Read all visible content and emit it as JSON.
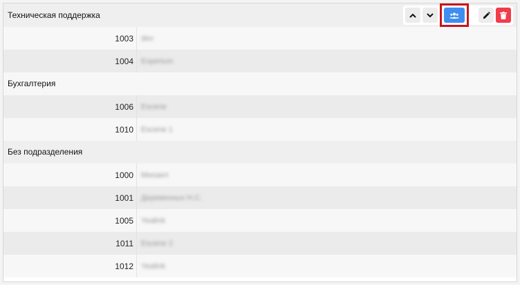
{
  "groups": [
    {
      "title": "Техническая поддержка",
      "rows": [
        {
          "number": "1003",
          "name": "dev"
        },
        {
          "number": "1004",
          "name": "Experium"
        }
      ]
    },
    {
      "title": "Бухгалтерия",
      "rows": [
        {
          "number": "1006",
          "name": "Escene"
        },
        {
          "number": "1010",
          "name": "Escene 1"
        }
      ]
    },
    {
      "title": "Без подразделения",
      "rows": [
        {
          "number": "1000",
          "name": "Михаил"
        },
        {
          "number": "1001",
          "name": "Деревенных Н.С."
        },
        {
          "number": "1005",
          "name": "Yealink"
        },
        {
          "number": "1011",
          "name": "Escene 2"
        },
        {
          "number": "1012",
          "name": "Yealink"
        }
      ]
    }
  ],
  "actions": {
    "icons": [
      "chevron-up-icon",
      "chevron-down-icon",
      "group-users-icon",
      "pencil-icon",
      "trash-icon"
    ],
    "colors": {
      "primary": "#3d8ef0",
      "danger": "#f13c4b",
      "highlight": "#c8141b"
    }
  }
}
